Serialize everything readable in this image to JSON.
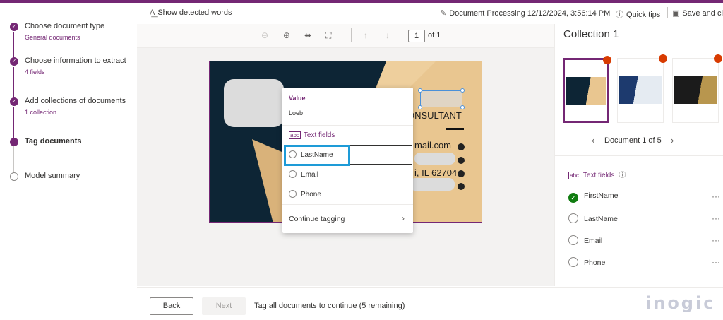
{
  "wizard": {
    "steps": [
      {
        "title": "Choose document type",
        "sub": "General documents"
      },
      {
        "title": "Choose information to extract",
        "sub": "4 fields"
      },
      {
        "title": "Add collections of documents",
        "sub": "1 collection"
      },
      {
        "title": "Tag documents",
        "sub": ""
      },
      {
        "title": "Model summary",
        "sub": ""
      }
    ]
  },
  "toolbar": {
    "show_words": "Show detected words",
    "doc_title": "Document Processing 12/12/2024, 3:56:14 PM",
    "quick_tips": "Quick tips",
    "save": "Save and cl"
  },
  "viewer": {
    "page_current": "1",
    "page_of": "of 1"
  },
  "card": {
    "consultant": "ONSULTANT",
    "email": "mail.com",
    "address": "i, IL 62704"
  },
  "popup": {
    "value_label": "Value",
    "value": "Loeb",
    "section": "Text fields",
    "options": [
      "LastName",
      "Email",
      "Phone"
    ],
    "continue": "Continue tagging"
  },
  "right": {
    "title": "Collection 1",
    "doc_nav": "Document 1 of 5",
    "section": "Text fields",
    "fields": [
      {
        "label": "FirstName",
        "done": true
      },
      {
        "label": "LastName",
        "done": false
      },
      {
        "label": "Email",
        "done": false
      },
      {
        "label": "Phone",
        "done": false
      }
    ]
  },
  "footer": {
    "back": "Back",
    "next": "Next",
    "message": "Tag all documents to continue (5 remaining)"
  },
  "brand": {
    "logo": "inogic"
  },
  "colors": {
    "accent": "#742774",
    "success": "#107c10",
    "badge": "#d83b01",
    "highlight": "#1e9bd7"
  }
}
